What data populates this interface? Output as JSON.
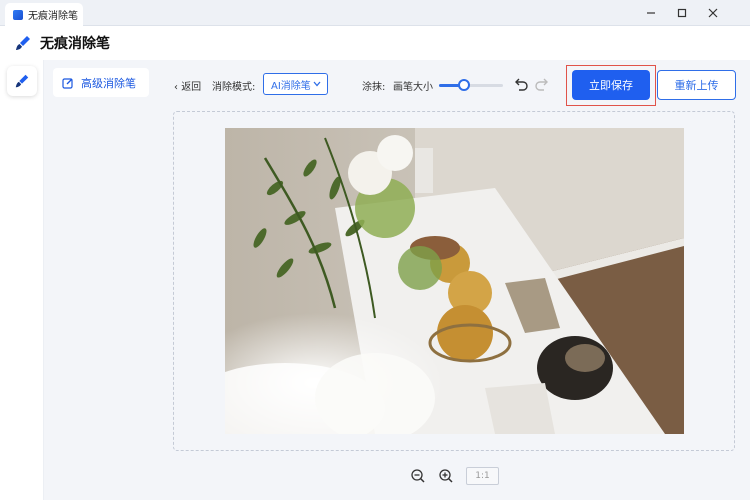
{
  "window": {
    "tab_title": "无痕消除笔",
    "app_title": "无痕消除笔",
    "controls": [
      "minimize",
      "maximize",
      "close"
    ]
  },
  "left_rail": {
    "tool_icon": "brush-icon"
  },
  "sidebar": {
    "items": [
      {
        "label": "高级消除笔",
        "icon": "edit-square-icon",
        "active": true
      }
    ]
  },
  "toolbar": {
    "back_label": "返回",
    "mode_label": "消除模式:",
    "mode_value": "AI消除笔",
    "erase_label": "涂抹:",
    "brush_size_label": "画笔大小",
    "brush_size_fraction": 0.4,
    "save_label": "立即保存",
    "reupload_label": "重新上传"
  },
  "zoom": {
    "actual_size_label": "1:1"
  },
  "colors": {
    "accent": "#1f5fef",
    "highlight": "#e0534a",
    "panel_bg": "#f3f5f9"
  }
}
